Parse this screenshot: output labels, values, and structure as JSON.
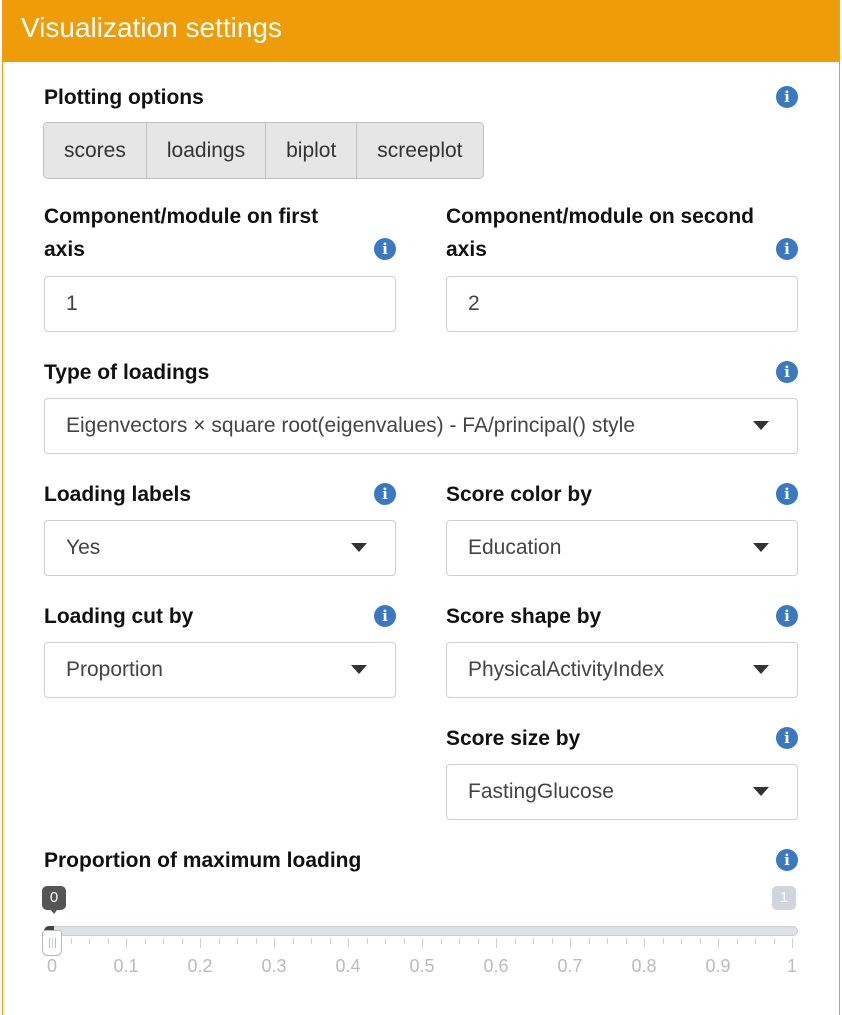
{
  "panel": {
    "title": "Visualization settings",
    "accent_color": "#ee9c0a",
    "info_icon_color": "#3a78c2"
  },
  "plotting_options": {
    "label": "Plotting options",
    "info_icon": "info-icon",
    "buttons": [
      "scores",
      "loadings",
      "biplot",
      "screeplot"
    ]
  },
  "first_axis": {
    "label_line1": "Component/module on first",
    "label_line2": "axis",
    "value": "1"
  },
  "second_axis": {
    "label_line1": "Component/module on second",
    "label_line2": "axis",
    "value": "2"
  },
  "type_of_loadings": {
    "label": "Type of loadings",
    "selected": "Eigenvectors × square root(eigenvalues) - FA/principal() style"
  },
  "loading_labels": {
    "label": "Loading labels",
    "selected": "Yes"
  },
  "score_color_by": {
    "label": "Score color by",
    "selected": "Education"
  },
  "loading_cut_by": {
    "label": "Loading cut by",
    "selected": "Proportion"
  },
  "score_shape_by": {
    "label": "Score shape by",
    "selected": "PhysicalActivityIndex"
  },
  "score_size_by": {
    "label": "Score size by",
    "selected": "FastingGlucose"
  },
  "proportion_slider": {
    "label": "Proportion of maximum loading",
    "from_value": "0",
    "to_value": "1",
    "current_fraction": 0,
    "tick_labels": [
      "0",
      "0.1",
      "0.2",
      "0.3",
      "0.4",
      "0.5",
      "0.6",
      "0.7",
      "0.8",
      "0.9",
      "1"
    ]
  }
}
